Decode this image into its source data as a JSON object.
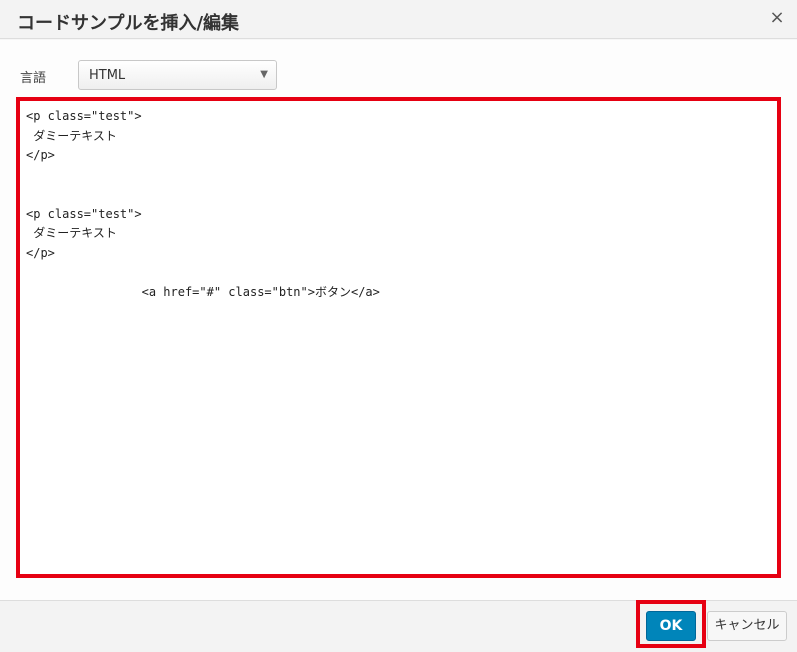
{
  "dialog": {
    "title": "コードサンプルを挿入/編集",
    "close_icon_glyph": "×"
  },
  "language": {
    "label": "言語",
    "selected": "HTML",
    "arrow_glyph": "▼"
  },
  "code": {
    "content": "<p class=\"test\">\n ダミーテキスト\n</p>\n\n\n<p class=\"test\">\n ダミーテキスト\n</p>\n\n\t\t<a href=\"#\" class=\"btn\">ボタン</a>"
  },
  "footer": {
    "ok_label": "OK",
    "cancel_label": "キャンセル"
  },
  "colors": {
    "highlight": "#e60012",
    "primary_button": "#0085ba"
  }
}
